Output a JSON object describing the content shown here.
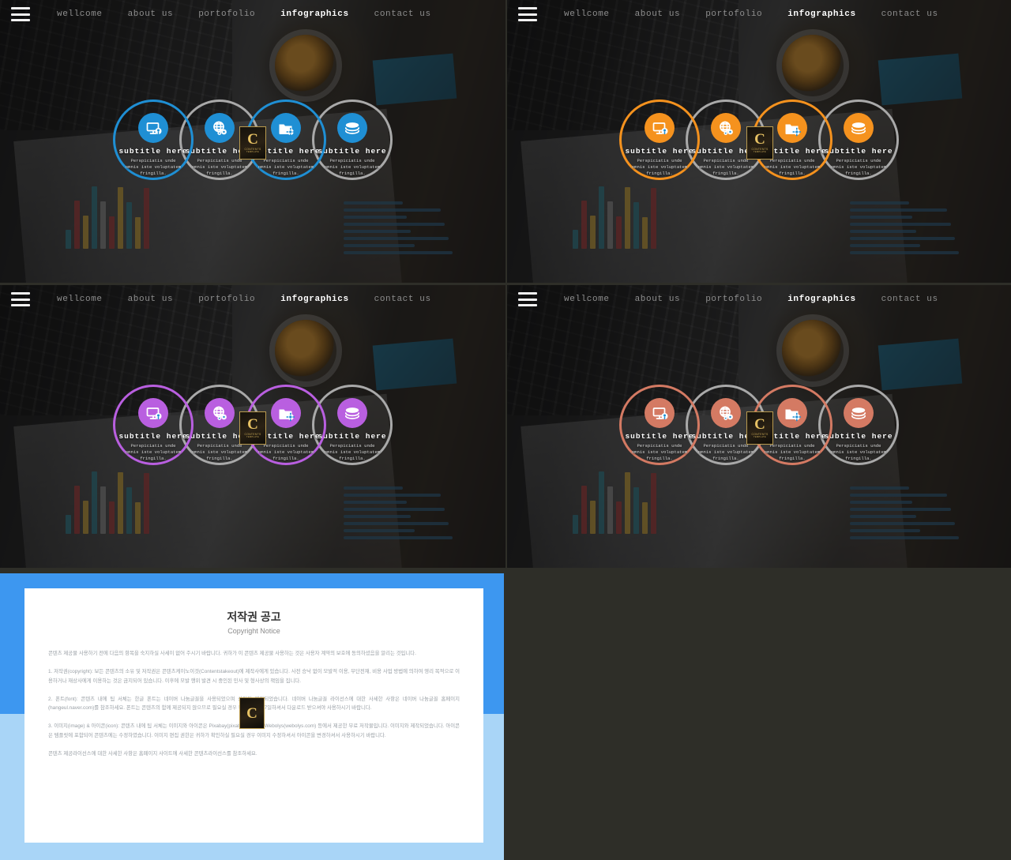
{
  "background_color": "#2e2e28",
  "nav": {
    "menu_icon": "hamburger-menu-icon",
    "items": [
      {
        "label": "wellcome",
        "active": false
      },
      {
        "label": "about us",
        "active": false
      },
      {
        "label": "portofolio",
        "active": false
      },
      {
        "label": "infographics",
        "active": true
      },
      {
        "label": "contact us",
        "active": false
      }
    ]
  },
  "cards": [
    {
      "icon": "monitor-pin-icon",
      "subtitle": "subtitle here",
      "description": "Perspiciatis unde omnis iste voluptatem fringilla."
    },
    {
      "icon": "globe-gears-icon",
      "subtitle": "subtitle here",
      "description": "Perspiciatis unde omnis iste voluptatem fringilla."
    },
    {
      "icon": "folder-gear-icon",
      "subtitle": "subtitle here",
      "description": "Perspiciatis unde omnis iste voluptatem fringilla."
    },
    {
      "icon": "layers-stack-icon",
      "subtitle": "subtitle here",
      "description": "Perspiciatis unde omnis iste voluptatem fringilla."
    }
  ],
  "panels": [
    {
      "id": "panel-blue",
      "accent": "#1f8fd4"
    },
    {
      "id": "panel-orange",
      "accent": "#f5921e"
    },
    {
      "id": "panel-purple",
      "accent": "#b95fe0"
    },
    {
      "id": "panel-salmon",
      "accent": "#d47a63"
    }
  ],
  "watermark": {
    "letter": "C",
    "line1": "CONTENTS",
    "line2": "TEMPLATE"
  },
  "document": {
    "frame_top_color": "#3d97f0",
    "frame_bottom_color": "#a9d5f7",
    "title": "저작권 공고",
    "subtitle": "Copyright Notice",
    "paragraphs": [
      "콘텐츠 제공물 사용하기 전에 다음의 항목을 숙지하실 사세이 없어 주시기 바랍니다. 귀하가 이 콘텐츠 제공물 사용하는 것은 사용자 계약의 보호에 동의하셨음을 알리는 것입니다.",
      "1. 저작권(copyright): 보든 콘텐츠의 소유 및 저작권은 콘텐츠케이노이것(Contentstakeout)에 제작사에게 있습니다. 사전 승낙 없이 모발적 이용, 무단전재, 비용 사업 방법에 의하여 영리 목적으로 이용하거나 재상사에게 이용하는 것은 금지되어 있습니다. 이후에 모발 행위 발견 시 중인된 민사 및 형사상의 책임을 집니다.",
      "2. 폰트(font): 콘텐츠 내에 팁 서체는 한글 폰트는 네이버 나눔글꼴을 사용되었으며 상업이 제작되었습니다. 네이버 나눔글꼴 라이선스에 대한 사세한 사항은 네이버 나눔글꼴 홈페이지(hangeul.naver.com)를 참조하세요. 폰트는 콘텐츠의 함께 제공되지 않으므로 필요실 경우 무료 폰트를 7일하셔서 다운로드 받으셔야 사용하시기 바랍니다.",
      "3. 이미지(image) & 아이콘(icon): 콘텐츠 내에 팁 서체는 이미지와 아이콘은 Pixabay(pixabay.com)과 Webolys(webolys.com) 등에서 제공한 무료 저작물입니다. 이미지와 제작되었습니다. 아이콘은 템플릿에 포함되어 콘텐츠에는 수정하였습니다. 이미지 편집 권한은 귀하가 확인하실 필요실 경우 이미지 수정하셔서 아이콘을 변경하셔서 사용하시기 바랍니다.",
      "콘텐츠 제공라이선스에 대한 사세한 사항은 홈페이지 사이트에 사세한 콘텐츠라이선스를 참조하세요."
    ],
    "watermark_letter": "C"
  },
  "decor": {
    "bar_colors": [
      "#2f7b8a",
      "#a33a3a",
      "#c9a13a",
      "#2f7b8a",
      "#8c8c8c",
      "#a33a3a",
      "#c9a13a",
      "#2f7b8a",
      "#c9a13a",
      "#a33a3a"
    ]
  }
}
